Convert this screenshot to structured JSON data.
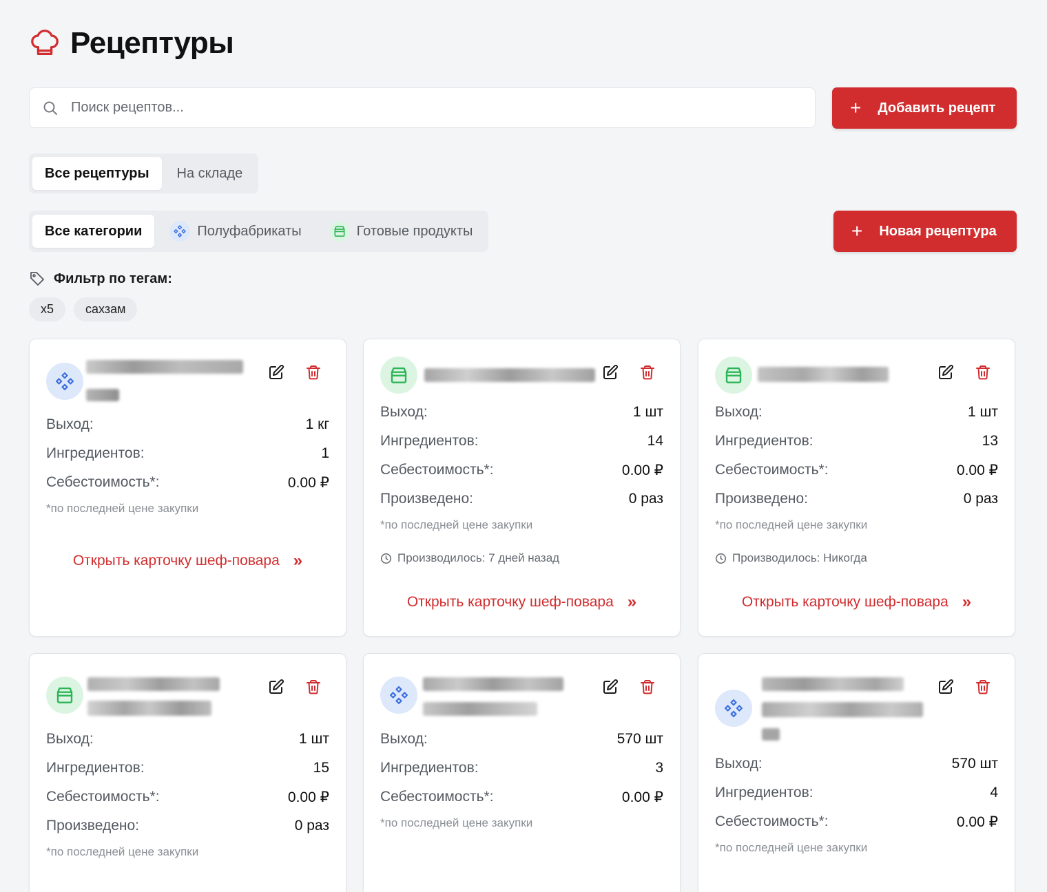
{
  "page": {
    "title": "Рецептуры",
    "icon": "chef-hat-icon"
  },
  "search": {
    "placeholder": "Поиск рецептов..."
  },
  "buttons": {
    "add_recipe": "Добавить рецепт",
    "new_recipe": "Новая рецептура"
  },
  "tabs": [
    {
      "label": "Все рецептуры",
      "active": true
    },
    {
      "label": "На складе",
      "active": false
    }
  ],
  "categories": [
    {
      "label": "Все категории",
      "active": true,
      "icon": ""
    },
    {
      "label": "Полуфабрикаты",
      "active": false,
      "icon": "diamonds-icon"
    },
    {
      "label": "Готовые продукты",
      "active": false,
      "icon": "package-icon"
    }
  ],
  "tag_filter": {
    "title": "Фильтр по тегам:",
    "tags": [
      "x5",
      "сахзам"
    ]
  },
  "labels": {
    "output": "Выход:",
    "ingredients": "Ингредиентов:",
    "cost": "Себестоимость*:",
    "produced": "Произведено:",
    "note": "*по последней цене закупки",
    "open_card": "Открыть карточку шеф-повара",
    "open_chevron": "»"
  },
  "colors": {
    "accent": "#d12d2f",
    "semi_bg": "#dde8fb",
    "semi_fg": "#3d6fe0",
    "ready_bg": "#dcf5e3",
    "ready_fg": "#2cb556"
  },
  "cards": [
    {
      "type": "semi",
      "output": "1 кг",
      "ingredients": "1",
      "cost": "0.00 ₽"
    },
    {
      "type": "ready",
      "output": "1 шт",
      "ingredients": "14",
      "cost": "0.00 ₽",
      "produced": "0 раз",
      "last_produced": "Производилось: 7 дней назад"
    },
    {
      "type": "ready",
      "output": "1 шт",
      "ingredients": "13",
      "cost": "0.00 ₽",
      "produced": "0 раз",
      "last_produced": "Производилось: Никогда"
    },
    {
      "type": "ready",
      "output": "1 шт",
      "ingredients": "15",
      "cost": "0.00 ₽",
      "produced": "0 раз"
    },
    {
      "type": "semi",
      "output": "570 шт",
      "ingredients": "3",
      "cost": "0.00 ₽"
    },
    {
      "type": "semi",
      "output": "570 шт",
      "ingredients": "4",
      "cost": "0.00 ₽"
    }
  ]
}
